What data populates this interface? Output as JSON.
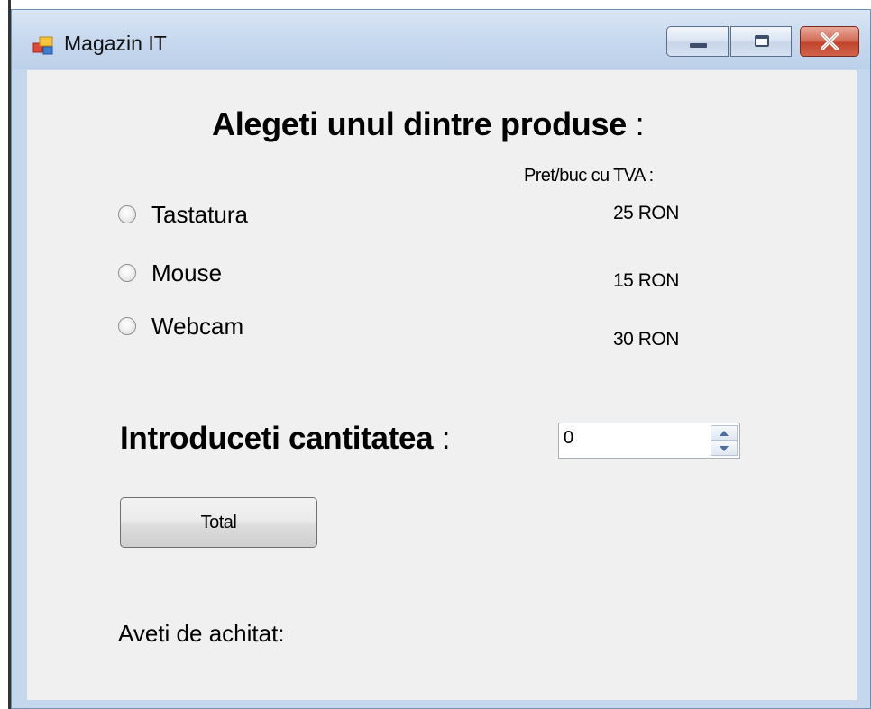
{
  "window": {
    "title": "Magazin IT"
  },
  "form": {
    "heading": "Alegeti unul dintre produse",
    "heading_colon": ":",
    "price_header": "Pret/buc cu TVA :",
    "products": [
      {
        "label": "Tastatura",
        "price": "25 RON",
        "selected": false
      },
      {
        "label": "Mouse",
        "price": "15 RON",
        "selected": false
      },
      {
        "label": "Webcam",
        "price": "30 RON",
        "selected": false
      }
    ],
    "quantity_label": "Introduceti cantitatea",
    "quantity_colon": ":",
    "quantity_value": "0",
    "total_button": "Total",
    "payable_label": "Aveti de achitat:"
  },
  "icons": {
    "app": "form-window-icon",
    "minimize": "minimize-icon",
    "maximize": "maximize-icon",
    "close": "close-icon",
    "spin_up": "arrow-up-icon",
    "spin_down": "arrow-down-icon"
  },
  "colors": {
    "titlebar": "#c6d8ee",
    "client_bg": "#f0f0f0",
    "close_button": "#c2452d"
  }
}
